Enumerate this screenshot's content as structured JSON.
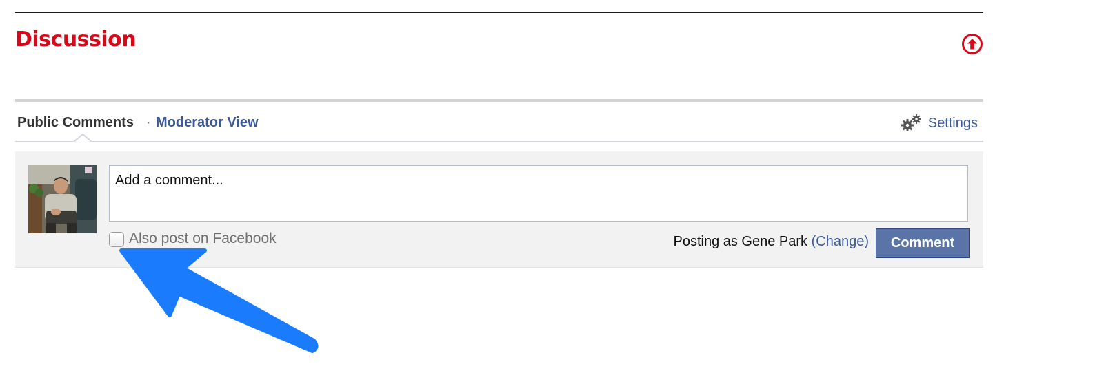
{
  "section": {
    "title": "Discussion",
    "accent_color": "#d6091b",
    "collapse_icon": "arrow-up-circle-icon"
  },
  "comments_widget": {
    "tabs": [
      {
        "label": "Public Comments",
        "active": true
      },
      {
        "label": "Moderator View",
        "active": false
      }
    ],
    "tab_separator": "·",
    "settings": {
      "icon": "gears-icon",
      "label": "Settings"
    },
    "composer": {
      "avatar": "user-avatar",
      "placeholder": "Add a comment...",
      "also_post_label": "Also post on Facebook",
      "also_post_checked": false,
      "posting_as_prefix": "Posting as Gene Park",
      "change_link": "(Change)",
      "submit_label": "Comment"
    },
    "link_color": "#3b5998",
    "button_color": "#5b74a8"
  },
  "annotation": {
    "icon": "pointer-arrow-icon",
    "color": "#1a7cfc"
  }
}
